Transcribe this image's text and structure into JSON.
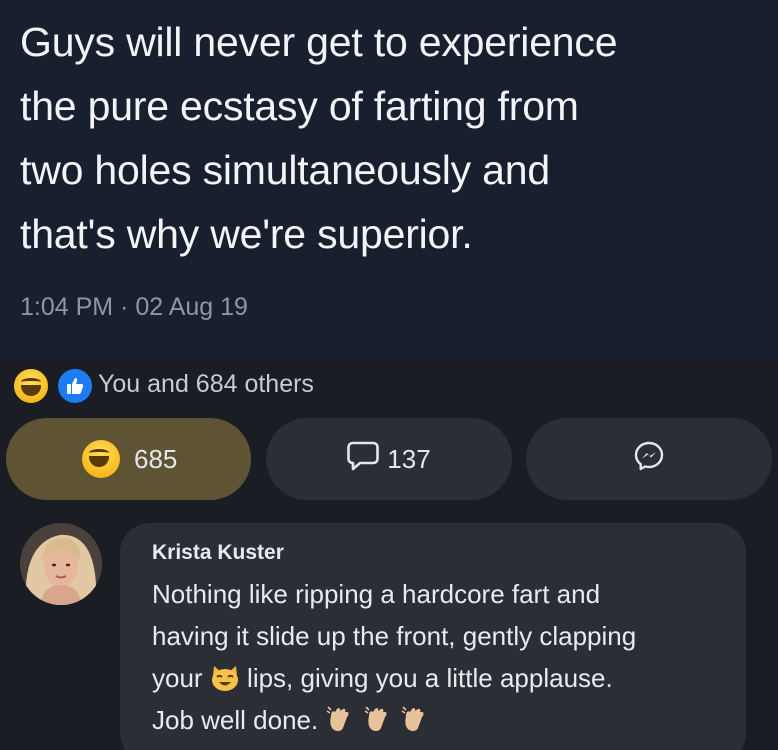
{
  "tweet": {
    "lines": [
      "Guys will never get to experience",
      "the pure ecstasy of farting from",
      "two holes simultaneously and",
      "that's why we're superior."
    ],
    "timestamp": "1:04 PM · 02 Aug 19"
  },
  "reactions": {
    "summary": "You and 684 others",
    "icons": [
      "haha-icon",
      "like-icon"
    ]
  },
  "actions": {
    "react_count": "685",
    "comment_count": "137",
    "react_icon": "haha-icon",
    "comment_icon": "comment-bubble-icon",
    "share_icon": "messenger-icon"
  },
  "comment": {
    "author": "Krista Kuster",
    "line1": "Nothing like ripping a hardcore fart and",
    "line2": "having it slide up the front, gently clapping",
    "line3_pre": "your",
    "line3_post": "lips, giving you a little applause.",
    "line4": "Job well done.",
    "emojis": [
      "cat-face-icon",
      "clapping-hands-icon",
      "clapping-hands-icon",
      "clapping-hands-icon"
    ]
  },
  "colors": {
    "tweet_bg": "#182030",
    "page_bg": "#1b1d24",
    "react_button_bg": "#5e5434",
    "button_bg": "#2c2e35",
    "like_blue": "#1d7cf2"
  }
}
